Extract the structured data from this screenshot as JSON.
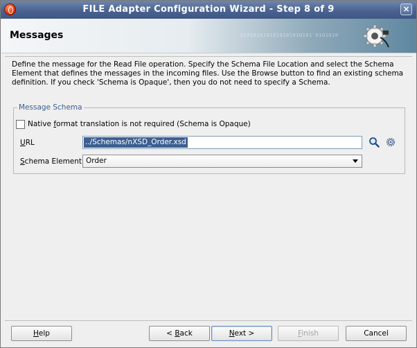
{
  "window": {
    "title": "FILE Adapter Configuration Wizard - Step 8 of 9",
    "close_glyph": "×"
  },
  "banner": {
    "heading": "Messages",
    "binary_pattern": "0101010101010101010101  0101010"
  },
  "description": "Define the message for the Read File operation.  Specify the Schema File Location and select the Schema Element that defines the messages in the incoming files. Use the Browse button to find an existing schema definition. If you check 'Schema is Opaque', then you do not need to specify a Schema.",
  "message_schema": {
    "legend": "Message Schema",
    "opaque_checkbox": {
      "checked": false,
      "label_pre": "Native ",
      "label_mnemonic": "f",
      "label_post": "ormat translation is not required (Schema is Opaque)"
    },
    "url": {
      "label_mnemonic": "U",
      "label_rest": "RL",
      "value": "../Schemas/nXSD_Order.xsd"
    },
    "schema_element": {
      "label_mnemonic": "S",
      "label_rest": "chema Element",
      "value": "Order"
    }
  },
  "buttons": {
    "help": {
      "mnemonic": "H",
      "rest": "elp"
    },
    "back": {
      "pre": "< ",
      "mnemonic": "B",
      "rest": "ack"
    },
    "next": {
      "mnemonic": "N",
      "rest": "ext >"
    },
    "finish": {
      "mnemonic": "F",
      "rest": "inish",
      "enabled": false
    },
    "cancel": {
      "label": "Cancel"
    }
  },
  "colors": {
    "titlebar": "#4a6391",
    "legend_text": "#3b5d8f",
    "selection": "#3d5f91"
  }
}
